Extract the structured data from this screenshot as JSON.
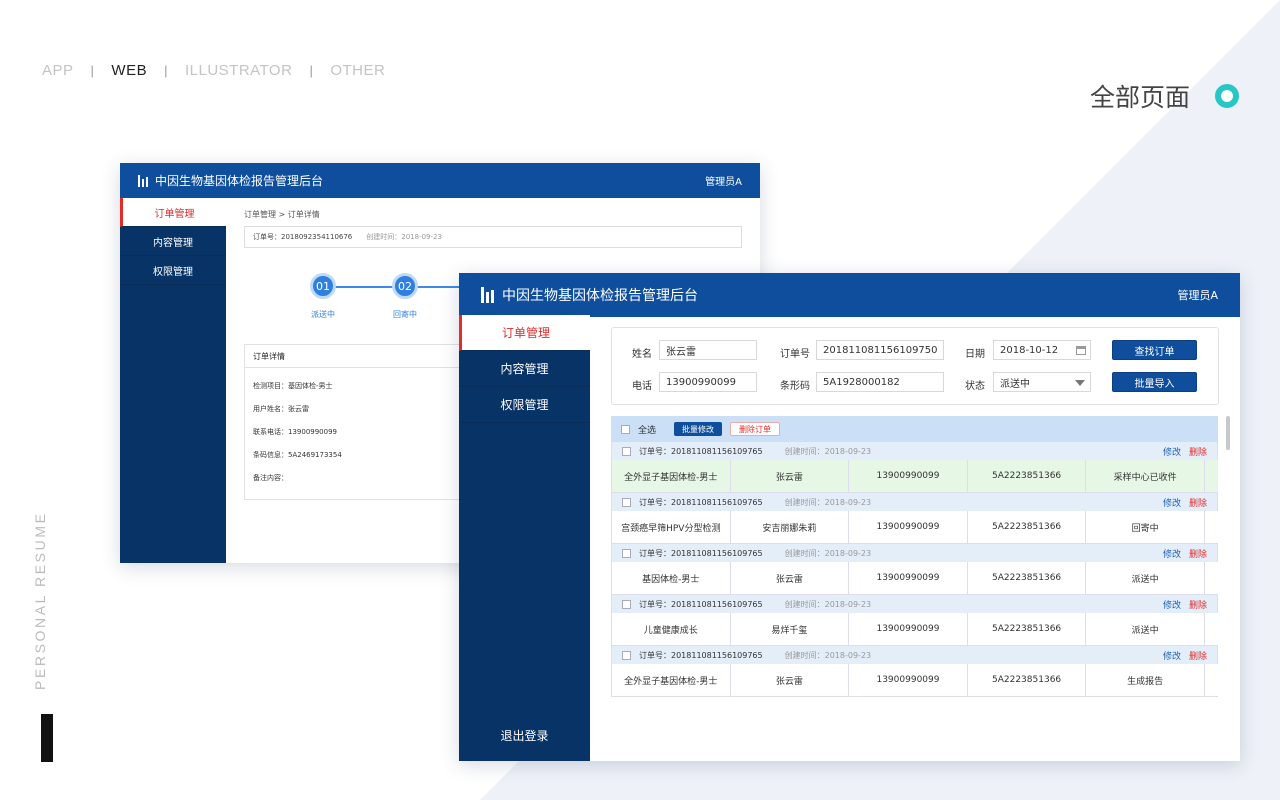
{
  "portfolio": {
    "nav": [
      "APP",
      "WEB",
      "ILLUSTRATOR",
      "OTHER"
    ],
    "nav_separator": "|",
    "active_nav": "WEB",
    "page_heading": "全部页面",
    "side_label": "PERSONAL RESUME",
    "accent_color": "#27c7c7"
  },
  "app": {
    "title": "中因生物基因体检报告管理后台",
    "admin": "管理员A",
    "menu": [
      "订单管理",
      "内容管理",
      "权限管理"
    ],
    "active_menu": "订单管理",
    "logout": "退出登录",
    "header_color": "#0f4e9c",
    "sidebar_color": "#083366"
  },
  "detail_page": {
    "breadcrumb": "订单管理 > 订单详情",
    "order_no": "订单号：2018092354110676",
    "created": "创建时间：2018-09-23",
    "steps": [
      {
        "num": "01",
        "label": "派送中"
      },
      {
        "num": "02",
        "label": "回寄中"
      }
    ],
    "detail_title": "订单详情",
    "fields": [
      "检测项目：基因体检-男士",
      "用户姓名：张云雷",
      "联系电话：13900990099",
      "条码信息：5A2469173354",
      "备注内容："
    ]
  },
  "list_page": {
    "search": {
      "name_label": "姓名",
      "name_value": "张云雷",
      "order_label": "订单号",
      "order_value": "201811081156109750",
      "date_label": "日期",
      "date_value": "2018-10-12",
      "phone_label": "电话",
      "phone_value": "13900990099",
      "barcode_label": "条形码",
      "barcode_value": "5A1928000182",
      "status_label": "状态",
      "status_value": "派送中",
      "find_button": "查找订单",
      "import_button": "批量导入"
    },
    "toolbar": {
      "select_all": "全选",
      "batch_edit": "批量修改",
      "delete": "删除订单"
    },
    "edit_label": "修改",
    "delete_label": "删除",
    "orders": [
      {
        "order_no": "订单号：201811081156109765",
        "created": "创建时间：2018-09-23",
        "cells": [
          "全外显子基因体检-男士",
          "张云雷",
          "13900990099",
          "5A2223851366",
          "采样中心已收件"
        ],
        "highlight": true
      },
      {
        "order_no": "订单号：201811081156109765",
        "created": "创建时间：2018-09-23",
        "cells": [
          "宫颈癌早筛HPV分型检测",
          "安吉丽娜朱莉",
          "13900990099",
          "5A2223851366",
          "回寄中"
        ],
        "highlight": false
      },
      {
        "order_no": "订单号：201811081156109765",
        "created": "创建时间：2018-09-23",
        "cells": [
          "基因体检-男士",
          "张云雷",
          "13900990099",
          "5A2223851366",
          "派送中"
        ],
        "highlight": false
      },
      {
        "order_no": "订单号：201811081156109765",
        "created": "创建时间：2018-09-23",
        "cells": [
          "儿童健康成长",
          "易烊千玺",
          "13900990099",
          "5A2223851366",
          "派送中"
        ],
        "highlight": false
      },
      {
        "order_no": "订单号：201811081156109765",
        "created": "创建时间：2018-09-23",
        "cells": [
          "全外显子基因体检-男士",
          "张云雷",
          "13900990099",
          "5A2223851366",
          "生成报告"
        ],
        "highlight": false
      }
    ]
  }
}
